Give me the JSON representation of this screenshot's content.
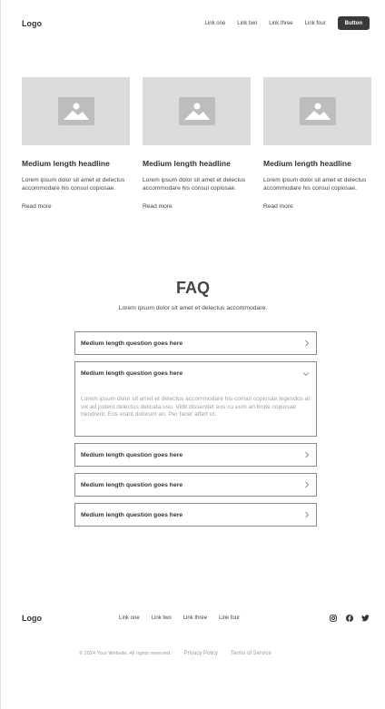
{
  "header": {
    "logo": "Logo",
    "nav": [
      "Link one",
      "Link two",
      "Link three",
      "Link four"
    ],
    "button": "Button"
  },
  "cards": [
    {
      "title": "Medium length headline",
      "text": "Lorem ipsum dolor sit amet et delectus accommodare his consul copiosae.",
      "link": "Read more",
      "image_icon": "image-placeholder-icon"
    },
    {
      "title": "Medium length headline",
      "text": "Lorem ipsum dolor sit amet et delectus accommodare his consul copiosae.",
      "link": "Read more",
      "image_icon": "image-placeholder-icon"
    },
    {
      "title": "Medium length headline",
      "text": "Lorem ipsum dolor sit amet et delectus accommodare his consul copiosae.",
      "link": "Read more",
      "image_icon": "image-placeholder-icon"
    }
  ],
  "faq": {
    "title": "FAQ",
    "subtitle": "Lorem ipsum dolor sit amet et delectus accommodare.",
    "items": [
      {
        "question": "Medium length question goes here",
        "open": false
      },
      {
        "question": "Medium length question goes here",
        "open": true,
        "answer": "Lorem ipsum dolor sit amet et delectus accommodare his consul copiosae legendos at vix ad putent delectus delicata usu. Vidit dissentiet eos cu eum an brute copiosae hendrerit. Eos erant dolorum an. Per facer affert ut."
      },
      {
        "question": "Medium length question goes here",
        "open": false
      },
      {
        "question": "Medium length question goes here",
        "open": false
      },
      {
        "question": "Medium length question goes here",
        "open": false
      }
    ]
  },
  "footer": {
    "logo": "Logo",
    "links": [
      "Link one",
      "Link two",
      "Link three",
      "Link four"
    ],
    "socials": [
      "instagram-icon",
      "facebook-icon",
      "twitter-icon"
    ],
    "copyright": "© 2024 Your Website. All rights reserved.",
    "privacy": "Privacy Policy",
    "terms": "Terms of Service"
  },
  "colors": {
    "image_placeholder": "#dcdcdc",
    "button_bg": "#3a3a3a",
    "border": "#8c8c8c",
    "muted_text": "#a0a0a0"
  }
}
